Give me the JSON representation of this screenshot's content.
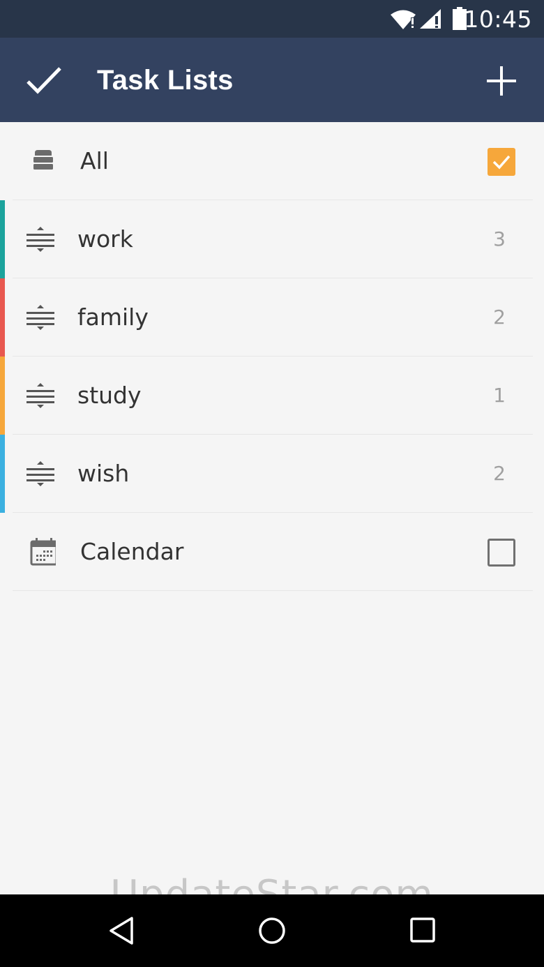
{
  "status_bar": {
    "time": "10:45",
    "icons": [
      "wifi-icon",
      "signal-icon",
      "battery-icon"
    ]
  },
  "app_bar": {
    "title": "Task Lists",
    "left_icon": "check-icon",
    "right_icon": "plus-icon"
  },
  "lists": {
    "all": {
      "label": "All",
      "checked": true,
      "icon": "stack-icon"
    },
    "items": [
      {
        "label": "work",
        "count": "3",
        "color": "#1ba39c"
      },
      {
        "label": "family",
        "count": "2",
        "color": "#e8584f"
      },
      {
        "label": "study",
        "count": "1",
        "color": "#f6a73b"
      },
      {
        "label": "wish",
        "count": "2",
        "color": "#3bb0e0"
      }
    ],
    "calendar": {
      "label": "Calendar",
      "checked": false,
      "icon": "calendar-icon"
    }
  },
  "watermark": "UpdateStar.com",
  "colors": {
    "status_bar": "#283549",
    "app_bar": "#334260",
    "accent": "#f6a73b",
    "background": "#f5f5f5"
  },
  "nav_bar": {
    "icons": [
      "back-icon",
      "home-icon",
      "recents-icon"
    ]
  }
}
